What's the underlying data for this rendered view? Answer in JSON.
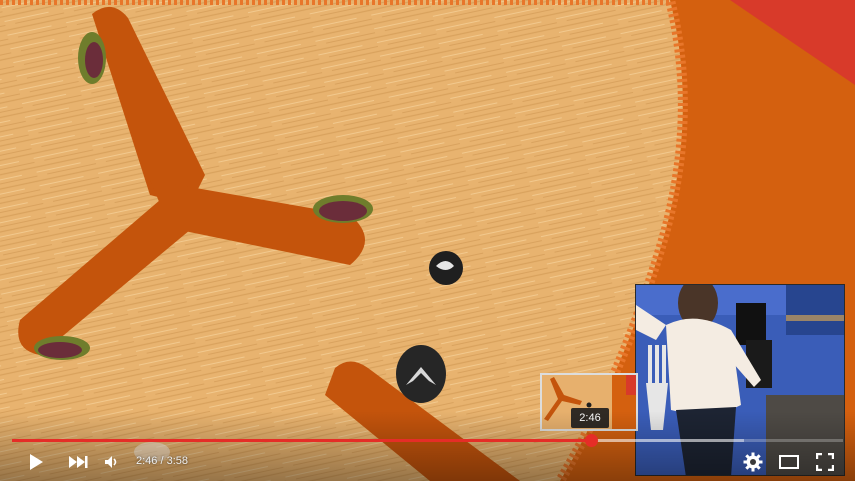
{
  "player": {
    "current_time": "2:46",
    "duration": "3:58",
    "time_separator": " / ",
    "preview_time": "2:46",
    "progress_played": 0.697,
    "progress_loaded": 0.881
  },
  "controls": {
    "play_icon": "play-icon",
    "next_icon": "skip-next-icon",
    "volume_icon": "volume-icon",
    "settings_icon": "gear-icon",
    "theater_icon": "theater-mode-icon",
    "fullscreen_icon": "fullscreen-icon"
  },
  "colors": {
    "progress_red": "#e52d27",
    "table_wood": "#e7b06d",
    "sauce_orange": "#c6550b",
    "corner_red": "#d83a2a"
  }
}
